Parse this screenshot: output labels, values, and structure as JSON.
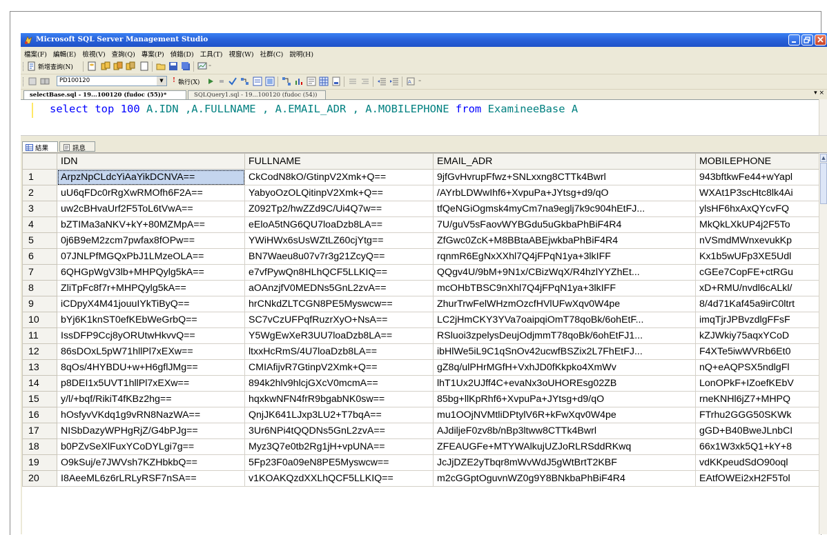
{
  "window": {
    "title": "Microsoft SQL Server Management Studio"
  },
  "menu": [
    "檔案(F)",
    "編輯(E)",
    "檢視(V)",
    "查詢(Q)",
    "專案(P)",
    "偵錯(D)",
    "工具(T)",
    "視窗(W)",
    "社群(C)",
    "說明(H)"
  ],
  "toolbar1": {
    "new_query_label": "新增查詢(N)"
  },
  "toolbar2": {
    "database": "PD100120",
    "execute_label": "執行(X)"
  },
  "tabs": {
    "active": "selectBase.sql - 19...100120 (fudoc (55))*",
    "inactive": "SQLQuery1.sql - 19...100120 (fudoc (54))",
    "controls": "▾ ×"
  },
  "editor": {
    "kw1": "select top 100 ",
    "cols": "A.IDN ,A.FULLNAME , A.EMAIL_ADR , A.MOBILEPHONE ",
    "kw2": "from ",
    "table": "ExamineeBase A"
  },
  "result_tabs": {
    "results": "結果",
    "messages": "訊息"
  },
  "grid": {
    "columns": [
      "IDN",
      "FULLNAME",
      "EMAIL_ADR",
      "MOBILEPHONE"
    ],
    "rows": [
      [
        "1",
        "ArpzNpCLdcYiAaYikDCNVA==",
        "CkCodN8kO/GtinpV2Xmk+Q==",
        "9jfGvHvrupFfwz+SNLxxng8CTTk4Bwrl",
        "943bftkwFe44+wYapl"
      ],
      [
        "2",
        "uU6qFDc0rRgXwRMOfh6F2A==",
        "YabyoOzOLQitinpV2Xmk+Q==",
        "/AYrbLDWwIhf6+XvpuPa+JYtsg+d9/qO",
        "WXAt1P3scHtc8lk4Ai"
      ],
      [
        "3",
        "uw2cBHvaUrf2F5ToL6tVwA==",
        "Z092Tp2/hwZZd9C/Ui4Q7w==",
        "tfQeNGiOgmsk4myCm7na9eglj7k9c904hEtFJ...",
        "ylsHF6hxAxQYcvFQ"
      ],
      [
        "4",
        "bZTIMa3aNKV+kY+80MZMpA==",
        "eEloA5tNG6QU7loaDzb8LA==",
        "7U/guV5sFaovWYBGdu5uGkbaPhBiF4R4",
        "MkQkLXkUP4j2F5To"
      ],
      [
        "5",
        "0j6B9eM2zcm7pwfax8fOPw==",
        "YWiHWx6sUsWZtLZ60cjYtg==",
        "ZfGwc0ZcK+M8BBtaABEjwkbaPhBiF4R4",
        "nVSmdMWnxevukKp"
      ],
      [
        "6",
        "07JNLPfMGQxPbJ1LMzeOLA==",
        "BN7Waeu8u07v7r3g21ZcyQ==",
        "rqnmR6EgNxXXhl7Q4jFPqN1ya+3lkIFF",
        "Kx1b5wUFp3XE5Udl"
      ],
      [
        "7",
        "6QHGpWgV3lb+MHPQylg5kA==",
        "e7vfPywQn8HLhQCF5LLKIQ==",
        "QQgv4U/9bM+9N1x/CBizWqX/R4hzlYYZhEt...",
        "cGEe7CopFE+ctRGu"
      ],
      [
        "8",
        "ZliTpFc8f7r+MHPQylg5kA==",
        "aOAnzjfV0MEDNs5GnL2zvA==",
        "mcOHbTBSC9nXhl7Q4jFPqN1ya+3lkIFF",
        "xD+RMU/nvdl6cALkl/"
      ],
      [
        "9",
        "iCDpyX4M41jouuIYkTiByQ==",
        "hrCNkdZLTCGN8PE5Myswcw==",
        "ZhurTrwFelWHzmOzcfHVlUFwXqv0W4pe",
        "8/4d71Kaf45a9irC0ltrt"
      ],
      [
        "10",
        "bYj6K1knST0efKEbWeGrbQ==",
        "SC7vCzUFPqfRuzrXyO+NsA==",
        "LC2jHmCKY3YVa7oaipqiOmT78qoBk/6ohEtF...",
        "imqTjrJPBvzdlgFFsF"
      ],
      [
        "11",
        "IssDFP9Ccj8yORUtwHkvvQ==",
        "Y5WgEwXeR3UU7loaDzb8LA==",
        "RSluoi3zpelysDeujOdjmmT78qoBk/6ohEtFJ1...",
        "kZJWkiy75aqxYCoD"
      ],
      [
        "12",
        "86sDOxL5pW71hllPl7xEXw==",
        "ltxxHcRmS/4U7loaDzb8LA==",
        "ibHlWe5iL9C1qSnOv42ucwfBSZix2L7FhEtFJ...",
        "F4XTe5iwWVRb6Et0"
      ],
      [
        "13",
        "8qOs/4HYBDU+w+H6gflJMg==",
        "CMIAfijvR7GtinpV2Xmk+Q==",
        "gZ8q/ulPHrMGfH+VxhJD0fKkpko4XmWv",
        "nQ+eAQPSX5ndlgFl"
      ],
      [
        "14",
        "p8DEI1x5UVT1hllPl7xEXw==",
        "894k2hlv9hlcjGXcV0mcmA==",
        "lhT1Ux2UJff4C+evaNx3oUHOREsg02ZB",
        "LonOPkF+IZoefKEbV"
      ],
      [
        "15",
        "y/l/+bqf/RikiT4fKBz2hg==",
        "hqxkwNFN4frR9bgabNK0sw==",
        "85bg+llKpRhf6+XvpuPa+JYtsg+d9/qO",
        "rneKNHl6jZ7+MHPQ"
      ],
      [
        "16",
        "hOsfyvVKdq1g9vRN8NazWA==",
        "QnjJK641LJxp3LU2+T7bqA==",
        "mu1OOjNVMtliDPtylV6R+kFwXqv0W4pe",
        "FTrhu2GGG50SKWk"
      ],
      [
        "17",
        "NISbDazyWPHgRjZ/G4bPJg==",
        "3Ur6NPi4tQQDNs5GnL2zvA==",
        "AJdiljeF0zv8b/nBp3ltww8CTTk4Bwrl",
        "gGD+B40BweJLnbCI"
      ],
      [
        "18",
        "b0PZvSeXlFuxYCoDYLgi7g==",
        "Myz3Q7e0tb2Rg1jH+vpUNA==",
        "ZFEAUGFe+MTYWAlkujUZJoRLRSddRKwq",
        "66x1W3xk5Q1+kY+8"
      ],
      [
        "19",
        "O9kSuj/e7JWVsh7KZHbkbQ==",
        "5Fp23F0a09eN8PE5Myswcw==",
        "JcJjDZE2yTbqr8mWvWdJ5gWtBrtT2KBF",
        "vdKKpeudSdO90oql"
      ],
      [
        "20",
        "I8AeeML6z6rLRLyRSF7nSA==",
        "v1KOAKQzdXXLhQCF5LLKIQ==",
        "m2cGGptOguvnWZ0g9Y8BNkbaPhBiF4R4",
        "EAtfOWEi2xH2F5Tol"
      ]
    ]
  },
  "colors": {
    "titlebar": "#2a63db",
    "keyword": "#0000ff",
    "object": "#008080",
    "selected_cell": "#c4d5ee"
  }
}
